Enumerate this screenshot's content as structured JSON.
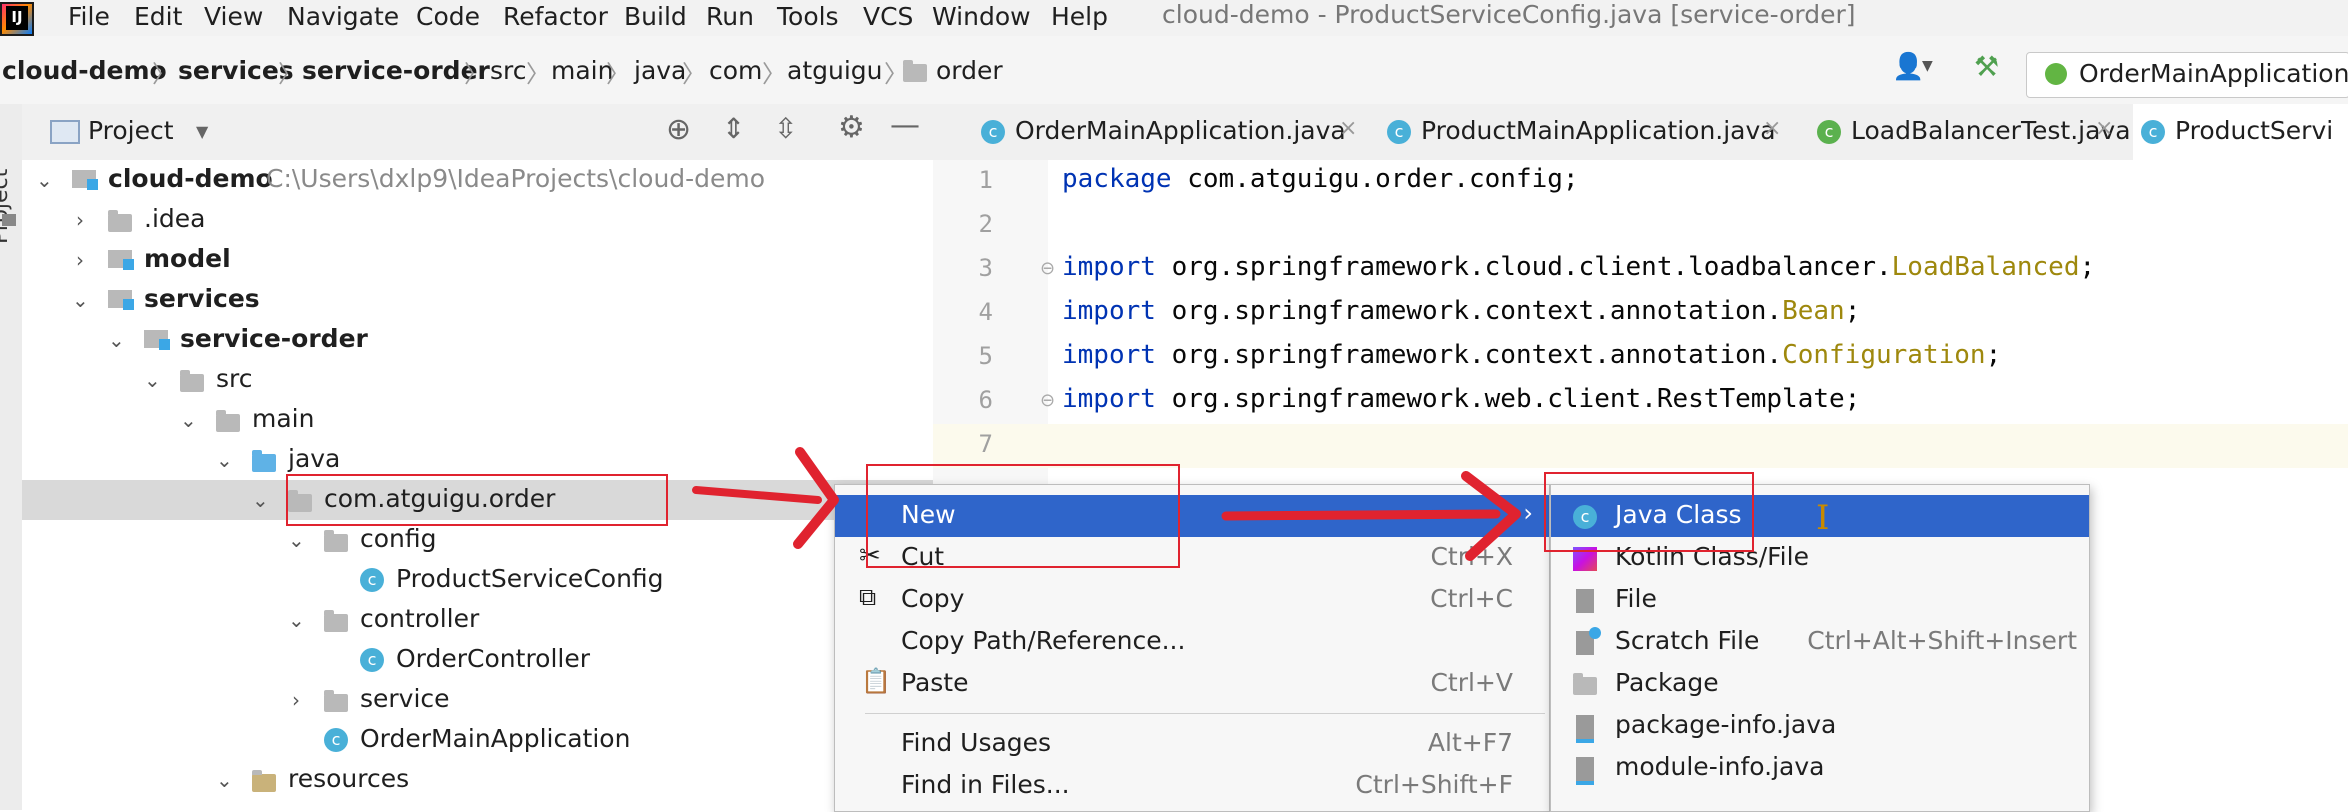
{
  "menubar": {
    "logo_text": "IJ",
    "items": [
      "File",
      "Edit",
      "View",
      "Navigate",
      "Code",
      "Refactor",
      "Build",
      "Run",
      "Tools",
      "VCS",
      "Window",
      "Help"
    ],
    "window_title": "cloud-demo - ProductServiceConfig.java [service-order]"
  },
  "breadcrumb": [
    "cloud-demo",
    "services",
    "service-order",
    "src",
    "main",
    "java",
    "com",
    "atguigu",
    "order"
  ],
  "toolbar": {
    "run_config": "OrderMainApplication"
  },
  "side_stripe": {
    "label": "Project"
  },
  "project_panel": {
    "title": "Project",
    "tree": [
      {
        "label": "cloud-demo",
        "hint": "C:\\Users\\dxlp9\\IdeaProjects\\cloud-demo"
      },
      {
        "label": ".idea"
      },
      {
        "label": "model"
      },
      {
        "label": "services"
      },
      {
        "label": "service-order"
      },
      {
        "label": "src"
      },
      {
        "label": "main"
      },
      {
        "label": "java"
      },
      {
        "label": "com.atguigu.order"
      },
      {
        "label": "config"
      },
      {
        "label": "ProductServiceConfig"
      },
      {
        "label": "controller"
      },
      {
        "label": "OrderController"
      },
      {
        "label": "service"
      },
      {
        "label": "OrderMainApplication"
      },
      {
        "label": "resources"
      }
    ]
  },
  "editor": {
    "tabs": [
      {
        "label": "OrderMainApplication.java"
      },
      {
        "label": "ProductMainApplication.java"
      },
      {
        "label": "LoadBalancerTest.java"
      },
      {
        "label": "ProductServi"
      }
    ],
    "lines": [
      {
        "n": "1",
        "kw": "package",
        "text": " com.atguigu.order.config;",
        "an": "",
        "tail": ""
      },
      {
        "n": "2",
        "kw": "",
        "text": "",
        "an": "",
        "tail": ""
      },
      {
        "n": "3",
        "kw": "import",
        "text": " org.springframework.cloud.client.loadbalancer.",
        "an": "LoadBalanced",
        "tail": ";"
      },
      {
        "n": "4",
        "kw": "import",
        "text": " org.springframework.context.annotation.",
        "an": "Bean",
        "tail": ";"
      },
      {
        "n": "5",
        "kw": "import",
        "text": " org.springframework.context.annotation.",
        "an": "Configuration",
        "tail": ";"
      },
      {
        "n": "6",
        "kw": "import",
        "text": " org.springframework.web.client.RestTemplate;",
        "an": "",
        "tail": ""
      },
      {
        "n": "7",
        "kw": "",
        "text": "",
        "an": "",
        "tail": ""
      }
    ]
  },
  "context_menu": {
    "items": [
      {
        "label": "New",
        "shortcut": ""
      },
      {
        "label": "Cut",
        "shortcut": "Ctrl+X"
      },
      {
        "label": "Copy",
        "shortcut": "Ctrl+C"
      },
      {
        "label": "Copy Path/Reference...",
        "shortcut": ""
      },
      {
        "label": "Paste",
        "shortcut": "Ctrl+V"
      },
      {
        "label": "Find Usages",
        "shortcut": "Alt+F7"
      },
      {
        "label": "Find in Files...",
        "shortcut": "Ctrl+Shift+F"
      }
    ]
  },
  "new_submenu": {
    "items": [
      {
        "label": "Java Class",
        "shortcut": "",
        "icon": "class-icon"
      },
      {
        "label": "Kotlin Class/File",
        "shortcut": "",
        "icon": "kotlin-icon"
      },
      {
        "label": "File",
        "shortcut": "",
        "icon": "file-icon"
      },
      {
        "label": "Scratch File",
        "shortcut": "Ctrl+Alt+Shift+Insert",
        "icon": "scratch-file-icon"
      },
      {
        "label": "Package",
        "shortcut": "",
        "icon": "package-icon"
      },
      {
        "label": "package-info.java",
        "shortcut": "",
        "icon": "java-file-icon"
      },
      {
        "label": "module-info.java",
        "shortcut": "",
        "icon": "java-file-icon"
      }
    ]
  },
  "colors": {
    "selection": "#2f65ca",
    "annotation_red": "#e0232f",
    "keyword": "#0033b3",
    "annotation": "#9e880d"
  }
}
